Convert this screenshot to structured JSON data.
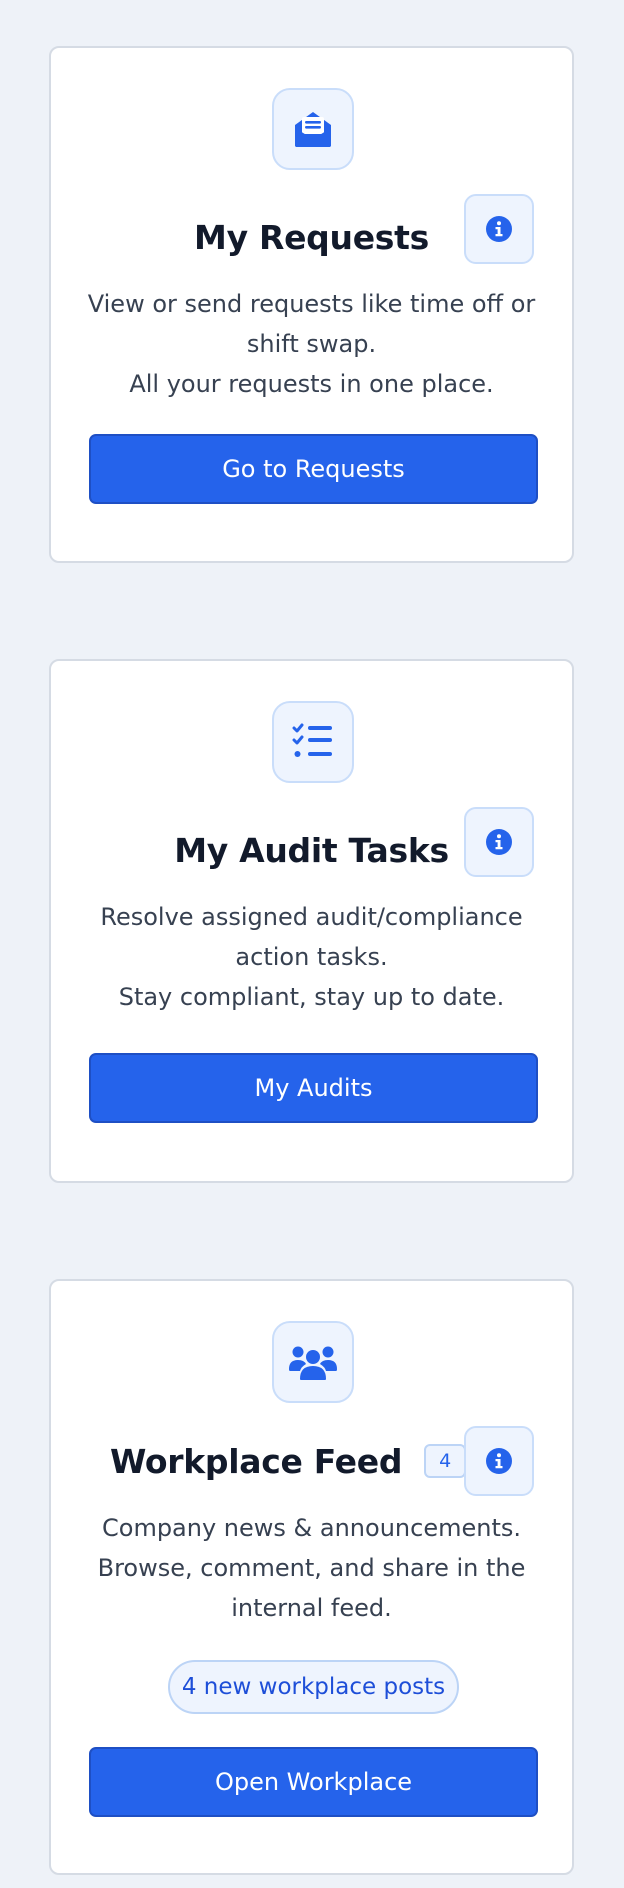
{
  "colors": {
    "page_background": "#eef2f8",
    "card_background": "#ffffff",
    "accent": "#2563eb",
    "title_text": "#121a2b",
    "body_text": "#374151"
  },
  "cards": [
    {
      "icon": "envelope-open-icon",
      "title": "My Requests",
      "description": [
        "View or send requests like time off or",
        "shift swap.",
        "All your requests in one place."
      ],
      "button_label": "Go to Requests"
    },
    {
      "icon": "checklist-icon",
      "title": "My Audit Tasks",
      "description": [
        "Resolve assigned audit/compliance",
        "action tasks.",
        "Stay compliant, stay up to date."
      ],
      "button_label": "My Audits"
    },
    {
      "icon": "users-group-icon",
      "title": "Workplace Feed",
      "badge_count": "4",
      "description": [
        "Company news & announcements.",
        "Browse, comment, and share in the",
        "internal feed."
      ],
      "status_pill": "4 new workplace posts",
      "button_label": "Open Workplace"
    }
  ]
}
